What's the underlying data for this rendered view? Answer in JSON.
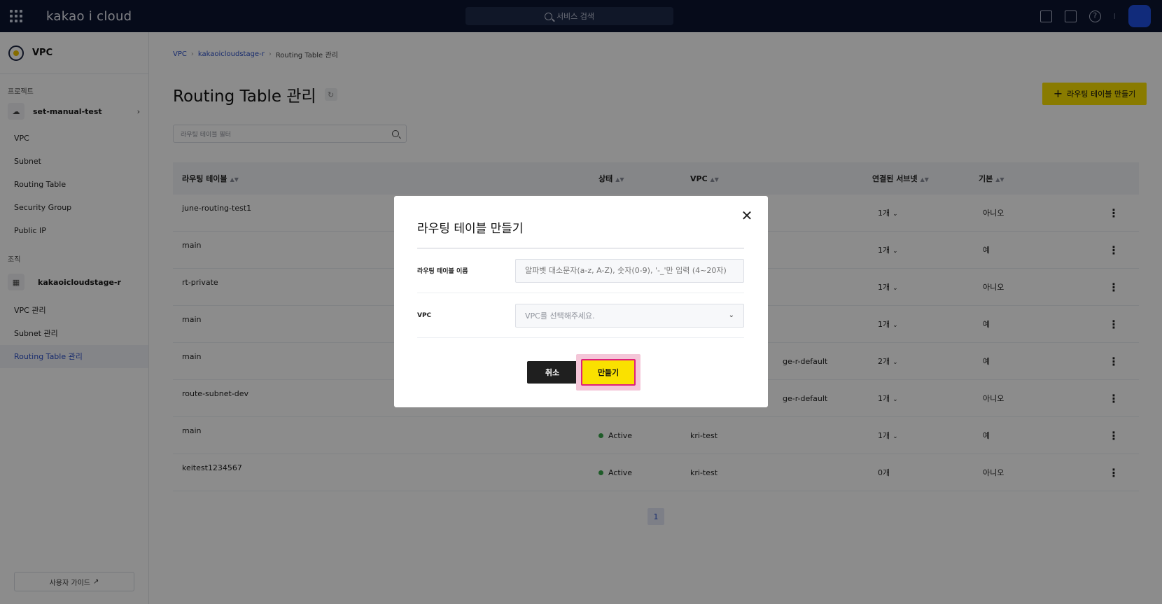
{
  "topbar": {
    "logo": "kakao i cloud",
    "search_placeholder": "서비스 검색",
    "separator": "I"
  },
  "sidebar": {
    "service_title": "VPC",
    "project_section": "프로젝트",
    "project_name": "set-manual-test",
    "project_items": [
      "VPC",
      "Subnet",
      "Routing Table",
      "Security Group",
      "Public IP"
    ],
    "org_section": "조직",
    "org_name": "kakaoicloudstage-r",
    "org_items": [
      "VPC 관리",
      "Subnet 관리",
      "Routing Table 관리"
    ],
    "active_item": "Routing Table 관리",
    "guide_label": "사용자 가이드"
  },
  "breadcrumb": [
    "VPC",
    "kakaoicloudstage-r",
    "Routing Table 관리"
  ],
  "page_title": "Routing Table 관리",
  "create_button": "라우팅 테이블 만들기",
  "filter_placeholder": "라우팅 테이블 필터",
  "table": {
    "headers": [
      "라우팅 테이블",
      "상태",
      "VPC",
      "연결된 서브넷",
      "기본"
    ],
    "rows": [
      {
        "name": "june-routing-test1",
        "status": "",
        "vpc": "",
        "subnets": "1개",
        "default": "아니오"
      },
      {
        "name": "main",
        "status": "",
        "vpc": "",
        "subnets": "1개",
        "default": "예"
      },
      {
        "name": "rt-private",
        "status": "",
        "vpc": "",
        "subnets": "1개",
        "default": "아니오"
      },
      {
        "name": "main",
        "status": "",
        "vpc": "",
        "subnets": "1개",
        "default": "예"
      },
      {
        "name": "main",
        "status": "",
        "vpc": "ge-r-default",
        "subnets": "2개",
        "default": "예"
      },
      {
        "name": "route-subnet-dev",
        "status": "",
        "vpc": "ge-r-default",
        "subnets": "1개",
        "default": "아니오"
      },
      {
        "name": "main",
        "status": "Active",
        "vpc": "kri-test",
        "subnets": "1개",
        "default": "예"
      },
      {
        "name": "keitest1234567",
        "status": "Active",
        "vpc": "kri-test",
        "subnets": "0개",
        "default": "아니오"
      }
    ]
  },
  "pagination": {
    "current": "1"
  },
  "modal": {
    "title": "라우팅 테이블 만들기",
    "name_label": "라우팅 테이블 이름",
    "name_placeholder": "알파벳 대소문자(a-z, A-Z), 숫자(0-9), '-_'만 입력 (4~20자)",
    "vpc_label": "VPC",
    "vpc_placeholder": "VPC를 선택해주세요.",
    "cancel_label": "취소",
    "ok_label": "만들기"
  },
  "colors": {
    "topbar": "#0b1530",
    "accent_yellow": "#fae100",
    "link_blue": "#2d50c7",
    "active_green": "#37a649",
    "highlight_pink": "#e0207a"
  }
}
